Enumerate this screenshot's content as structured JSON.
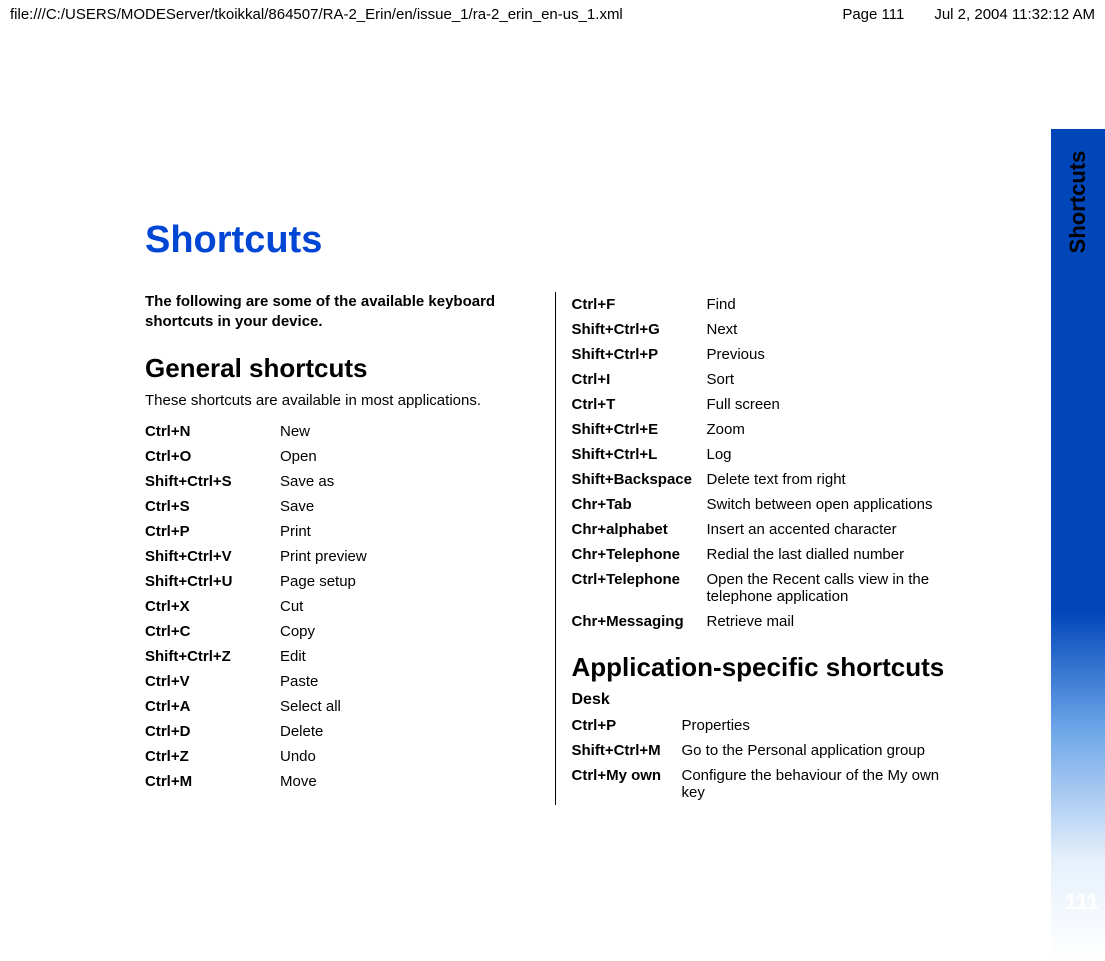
{
  "header": {
    "file_path": "file:///C:/USERS/MODEServer/tkoikkal/864507/RA-2_Erin/en/issue_1/ra-2_erin_en-us_1.xml",
    "page_label": "Page 111",
    "timestamp": "Jul 2, 2004 11:32:12 AM"
  },
  "title": "Shortcuts",
  "intro": "The following are some of the available keyboard shortcuts in your device.",
  "general": {
    "heading": "General shortcuts",
    "sub": "These shortcuts are available in most applications.",
    "left": [
      {
        "k": "Ctrl+N",
        "a": "New"
      },
      {
        "k": "Ctrl+O",
        "a": "Open"
      },
      {
        "k": "Shift+Ctrl+S",
        "a": "Save as"
      },
      {
        "k": "Ctrl+S",
        "a": "Save"
      },
      {
        "k": "Ctrl+P",
        "a": "Print"
      },
      {
        "k": "Shift+Ctrl+V",
        "a": "Print preview"
      },
      {
        "k": "Shift+Ctrl+U",
        "a": "Page setup"
      },
      {
        "k": "Ctrl+X",
        "a": "Cut"
      },
      {
        "k": "Ctrl+C",
        "a": "Copy"
      },
      {
        "k": "Shift+Ctrl+Z",
        "a": "Edit"
      },
      {
        "k": "Ctrl+V",
        "a": "Paste"
      },
      {
        "k": "Ctrl+A",
        "a": "Select all"
      },
      {
        "k": "Ctrl+D",
        "a": "Delete"
      },
      {
        "k": "Ctrl+Z",
        "a": "Undo"
      },
      {
        "k": "Ctrl+M",
        "a": "Move"
      }
    ],
    "right": [
      {
        "k": "Ctrl+F",
        "a": "Find"
      },
      {
        "k": "Shift+Ctrl+G",
        "a": "Next"
      },
      {
        "k": "Shift+Ctrl+P",
        "a": "Previous"
      },
      {
        "k": "Ctrl+I",
        "a": "Sort"
      },
      {
        "k": "Ctrl+T",
        "a": "Full screen"
      },
      {
        "k": "Shift+Ctrl+E",
        "a": "Zoom"
      },
      {
        "k": "Shift+Ctrl+L",
        "a": "Log"
      },
      {
        "k": "Shift+Backspace",
        "a": "Delete text from right"
      },
      {
        "k": "Chr+Tab",
        "a": "Switch between open applications"
      },
      {
        "k": "Chr+alphabet",
        "a": "Insert an accented character"
      },
      {
        "k": "Chr+Telephone",
        "a": "Redial the last dialled number"
      },
      {
        "k": "Ctrl+Telephone",
        "a": "Open the Recent calls view in the telephone application"
      },
      {
        "k": "Chr+Messaging",
        "a": "Retrieve mail"
      }
    ]
  },
  "app_specific": {
    "heading": "Application-specific shortcuts",
    "sections": [
      {
        "name": "Desk",
        "rows": [
          {
            "k": "Ctrl+P",
            "a": "Properties"
          },
          {
            "k": "Shift+Ctrl+M",
            "a": "Go to the Personal application group"
          },
          {
            "k": "Ctrl+My own",
            "a": "Configure the behaviour of the My own key"
          }
        ]
      }
    ]
  },
  "sidebar": {
    "tab_label": "Shortcuts",
    "page_number": "111"
  }
}
